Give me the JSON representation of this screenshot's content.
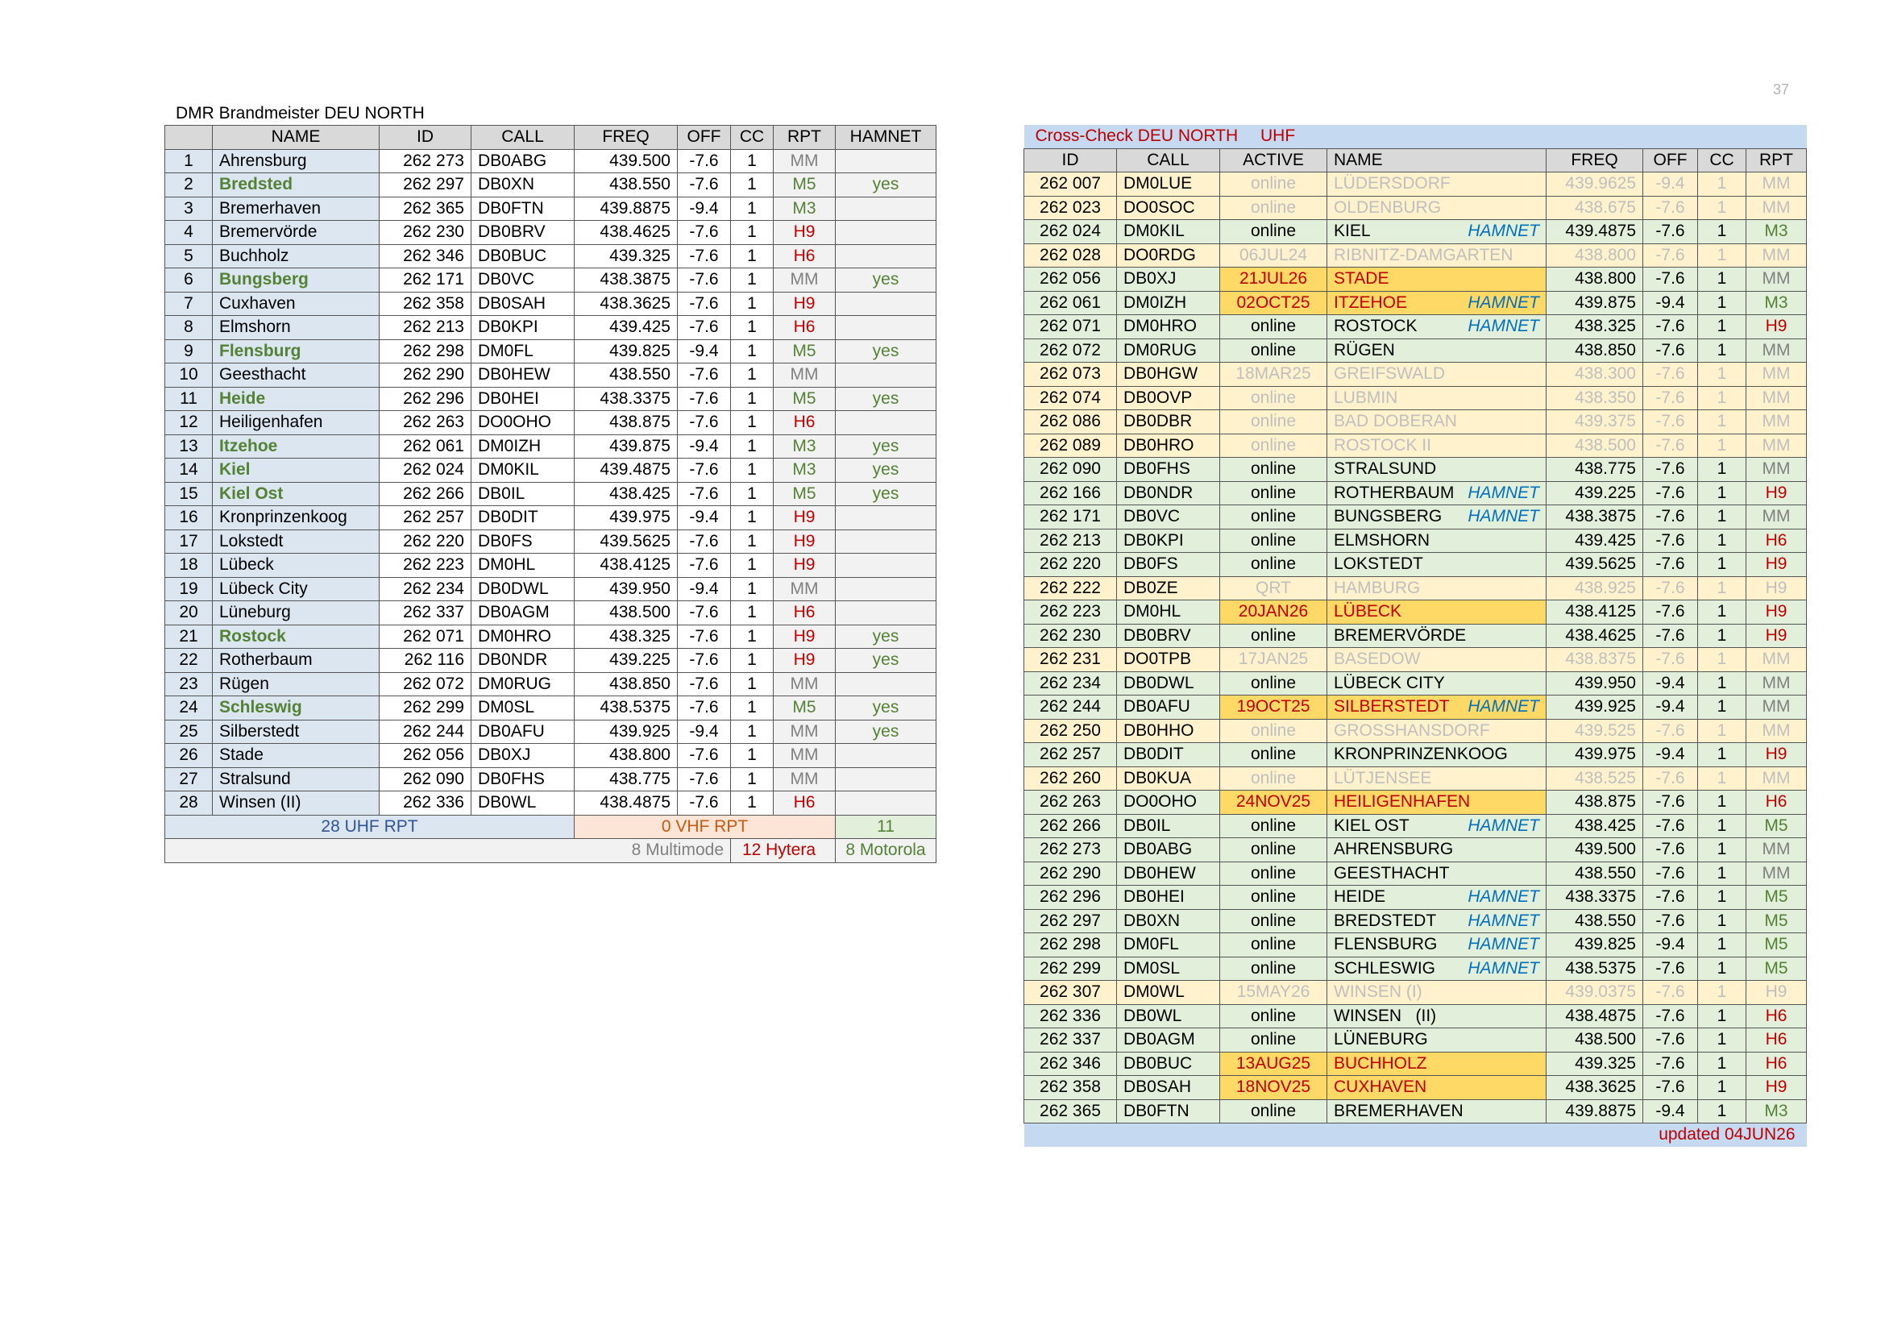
{
  "page_number": "37",
  "left": {
    "title": "DMR Brandmeister DEU NORTH",
    "headers": [
      "",
      "NAME",
      "ID",
      "CALL",
      "FREQ",
      "OFF",
      "CC",
      "RPT",
      "HAMNET"
    ],
    "rows": [
      {
        "n": "1",
        "name": "Ahrensburg",
        "id": "262 273",
        "call": "DB0ABG",
        "freq": "439.500",
        "off": "-7.6",
        "cc": "1",
        "rpt": "MM",
        "hamnet": "",
        "hl": false
      },
      {
        "n": "2",
        "name": "Bredsted",
        "id": "262 297",
        "call": "DB0XN",
        "freq": "438.550",
        "off": "-7.6",
        "cc": "1",
        "rpt": "M5",
        "hamnet": "yes",
        "hl": true
      },
      {
        "n": "3",
        "name": "Bremerhaven",
        "id": "262 365",
        "call": "DB0FTN",
        "freq": "439.8875",
        "off": "-9.4",
        "cc": "1",
        "rpt": "M3",
        "hamnet": "",
        "hl": false
      },
      {
        "n": "4",
        "name": "Bremervörde",
        "id": "262 230",
        "call": "DB0BRV",
        "freq": "438.4625",
        "off": "-7.6",
        "cc": "1",
        "rpt": "H9",
        "hamnet": "",
        "hl": false
      },
      {
        "n": "5",
        "name": "Buchholz",
        "id": "262 346",
        "call": "DB0BUC",
        "freq": "439.325",
        "off": "-7.6",
        "cc": "1",
        "rpt": "H6",
        "hamnet": "",
        "hl": false
      },
      {
        "n": "6",
        "name": "Bungsberg",
        "id": "262 171",
        "call": "DB0VC",
        "freq": "438.3875",
        "off": "-7.6",
        "cc": "1",
        "rpt": "MM",
        "hamnet": "yes",
        "hl": true
      },
      {
        "n": "7",
        "name": "Cuxhaven",
        "id": "262 358",
        "call": "DB0SAH",
        "freq": "438.3625",
        "off": "-7.6",
        "cc": "1",
        "rpt": "H9",
        "hamnet": "",
        "hl": false
      },
      {
        "n": "8",
        "name": "Elmshorn",
        "id": "262 213",
        "call": "DB0KPI",
        "freq": "439.425",
        "off": "-7.6",
        "cc": "1",
        "rpt": "H6",
        "hamnet": "",
        "hl": false
      },
      {
        "n": "9",
        "name": "Flensburg",
        "id": "262 298",
        "call": "DM0FL",
        "freq": "439.825",
        "off": "-9.4",
        "cc": "1",
        "rpt": "M5",
        "hamnet": "yes",
        "hl": true
      },
      {
        "n": "10",
        "name": "Geesthacht",
        "id": "262 290",
        "call": "DB0HEW",
        "freq": "438.550",
        "off": "-7.6",
        "cc": "1",
        "rpt": "MM",
        "hamnet": "",
        "hl": false
      },
      {
        "n": "11",
        "name": "Heide",
        "id": "262 296",
        "call": "DB0HEI",
        "freq": "438.3375",
        "off": "-7.6",
        "cc": "1",
        "rpt": "M5",
        "hamnet": "yes",
        "hl": true
      },
      {
        "n": "12",
        "name": "Heiligenhafen",
        "id": "262 263",
        "call": "DO0OHO",
        "freq": "438.875",
        "off": "-7.6",
        "cc": "1",
        "rpt": "H6",
        "hamnet": "",
        "hl": false
      },
      {
        "n": "13",
        "name": "Itzehoe",
        "id": "262 061",
        "call": "DM0IZH",
        "freq": "439.875",
        "off": "-9.4",
        "cc": "1",
        "rpt": "M3",
        "hamnet": "yes",
        "hl": true
      },
      {
        "n": "14",
        "name": "Kiel",
        "id": "262 024",
        "call": "DM0KIL",
        "freq": "439.4875",
        "off": "-7.6",
        "cc": "1",
        "rpt": "M3",
        "hamnet": "yes",
        "hl": true
      },
      {
        "n": "15",
        "name": "Kiel Ost",
        "id": "262 266",
        "call": "DB0IL",
        "freq": "438.425",
        "off": "-7.6",
        "cc": "1",
        "rpt": "M5",
        "hamnet": "yes",
        "hl": true
      },
      {
        "n": "16",
        "name": "Kronprinzenkoog",
        "id": "262 257",
        "call": "DB0DIT",
        "freq": "439.975",
        "off": "-9.4",
        "cc": "1",
        "rpt": "H9",
        "hamnet": "",
        "hl": false
      },
      {
        "n": "17",
        "name": "Lokstedt",
        "id": "262 220",
        "call": "DB0FS",
        "freq": "439.5625",
        "off": "-7.6",
        "cc": "1",
        "rpt": "H9",
        "hamnet": "",
        "hl": false
      },
      {
        "n": "18",
        "name": "Lübeck",
        "id": "262 223",
        "call": "DM0HL",
        "freq": "438.4125",
        "off": "-7.6",
        "cc": "1",
        "rpt": "H9",
        "hamnet": "",
        "hl": false
      },
      {
        "n": "19",
        "name": "Lübeck City",
        "id": "262 234",
        "call": "DB0DWL",
        "freq": "439.950",
        "off": "-9.4",
        "cc": "1",
        "rpt": "MM",
        "hamnet": "",
        "hl": false
      },
      {
        "n": "20",
        "name": "Lüneburg",
        "id": "262 337",
        "call": "DB0AGM",
        "freq": "438.500",
        "off": "-7.6",
        "cc": "1",
        "rpt": "H6",
        "hamnet": "",
        "hl": false
      },
      {
        "n": "21",
        "name": "Rostock",
        "id": "262 071",
        "call": "DM0HRO",
        "freq": "438.325",
        "off": "-7.6",
        "cc": "1",
        "rpt": "H9",
        "hamnet": "yes",
        "hl": true
      },
      {
        "n": "22",
        "name": "Rotherbaum",
        "id": "262 116",
        "call": "DB0NDR",
        "freq": "439.225",
        "off": "-7.6",
        "cc": "1",
        "rpt": "H9",
        "hamnet": "yes",
        "hl": false
      },
      {
        "n": "23",
        "name": "Rügen",
        "id": "262 072",
        "call": "DM0RUG",
        "freq": "438.850",
        "off": "-7.6",
        "cc": "1",
        "rpt": "MM",
        "hamnet": "",
        "hl": false
      },
      {
        "n": "24",
        "name": "Schleswig",
        "id": "262 299",
        "call": "DM0SL",
        "freq": "438.5375",
        "off": "-7.6",
        "cc": "1",
        "rpt": "M5",
        "hamnet": "yes",
        "hl": true
      },
      {
        "n": "25",
        "name": "Silberstedt",
        "id": "262 244",
        "call": "DB0AFU",
        "freq": "439.925",
        "off": "-9.4",
        "cc": "1",
        "rpt": "MM",
        "hamnet": "yes",
        "hl": false
      },
      {
        "n": "26",
        "name": "Stade",
        "id": "262 056",
        "call": "DB0XJ",
        "freq": "438.800",
        "off": "-7.6",
        "cc": "1",
        "rpt": "MM",
        "hamnet": "",
        "hl": false
      },
      {
        "n": "27",
        "name": "Stralsund",
        "id": "262 090",
        "call": "DB0FHS",
        "freq": "438.775",
        "off": "-7.6",
        "cc": "1",
        "rpt": "MM",
        "hamnet": "",
        "hl": false
      },
      {
        "n": "28",
        "name": "Winsen (II)",
        "id": "262 336",
        "call": "DB0WL",
        "freq": "438.4875",
        "off": "-7.6",
        "cc": "1",
        "rpt": "H6",
        "hamnet": "",
        "hl": false
      }
    ],
    "summary": {
      "uhf": "28  UHF RPT",
      "vhf": "0 VHF RPT",
      "hamnet_count": "11"
    },
    "vendors": {
      "multimode": "8 Multimode",
      "hytera": "12 Hytera",
      "motorola": "8 Motorola"
    }
  },
  "right": {
    "title": "Cross-Check DEU NORTH",
    "band": "UHF",
    "headers": [
      "ID",
      "CALL",
      "ACTIVE",
      "NAME",
      "FREQ",
      "OFF",
      "CC",
      "RPT"
    ],
    "rows": [
      {
        "id": "262 007",
        "call": "DM0LUE",
        "active": "online",
        "name": "LÜDERSDORF",
        "hamnet": "",
        "freq": "439.9625",
        "off": "-9.4",
        "cc": "1",
        "rpt": "MM",
        "st": "dim"
      },
      {
        "id": "262 023",
        "call": "DO0SOC",
        "active": "online",
        "name": "OLDENBURG",
        "hamnet": "",
        "freq": "438.675",
        "off": "-7.6",
        "cc": "1",
        "rpt": "MM",
        "st": "dim"
      },
      {
        "id": "262 024",
        "call": "DM0KIL",
        "active": "online",
        "name": "KIEL",
        "hamnet": "HAMNET",
        "freq": "439.4875",
        "off": "-7.6",
        "cc": "1",
        "rpt": "M3",
        "st": "ok"
      },
      {
        "id": "262 028",
        "call": "DO0RDG",
        "active": "06JUL24",
        "name": "RIBNITZ-DAMGARTEN",
        "hamnet": "",
        "freq": "438.800",
        "off": "-7.6",
        "cc": "1",
        "rpt": "MM",
        "st": "dim"
      },
      {
        "id": "262 056",
        "call": "DB0XJ",
        "active": "21JUL26",
        "name": "STADE",
        "hamnet": "",
        "freq": "438.800",
        "off": "-7.6",
        "cc": "1",
        "rpt": "MM",
        "st": "warn"
      },
      {
        "id": "262 061",
        "call": "DM0IZH",
        "active": "02OCT25",
        "name": "ITZEHOE",
        "hamnet": "HAMNET",
        "freq": "439.875",
        "off": "-9.4",
        "cc": "1",
        "rpt": "M3",
        "st": "warn"
      },
      {
        "id": "262 071",
        "call": "DM0HRO",
        "active": "online",
        "name": "ROSTOCK",
        "hamnet": "HAMNET",
        "freq": "438.325",
        "off": "-7.6",
        "cc": "1",
        "rpt": "H9",
        "st": "ok"
      },
      {
        "id": "262 072",
        "call": "DM0RUG",
        "active": "online",
        "name": "RÜGEN",
        "hamnet": "",
        "freq": "438.850",
        "off": "-7.6",
        "cc": "1",
        "rpt": "MM",
        "st": "ok"
      },
      {
        "id": "262 073",
        "call": "DB0HGW",
        "active": "18MAR25",
        "name": "GREIFSWALD",
        "hamnet": "",
        "freq": "438.300",
        "off": "-7.6",
        "cc": "1",
        "rpt": "MM",
        "st": "dim"
      },
      {
        "id": "262 074",
        "call": "DB0OVP",
        "active": "online",
        "name": "LUBMIN",
        "hamnet": "",
        "freq": "438.350",
        "off": "-7.6",
        "cc": "1",
        "rpt": "MM",
        "st": "dim"
      },
      {
        "id": "262 086",
        "call": "DB0DBR",
        "active": "online",
        "name": "BAD DOBERAN",
        "hamnet": "",
        "freq": "439.375",
        "off": "-7.6",
        "cc": "1",
        "rpt": "MM",
        "st": "dim"
      },
      {
        "id": "262 089",
        "call": "DB0HRO",
        "active": "online",
        "name": "ROSTOCK II",
        "hamnet": "",
        "freq": "438.500",
        "off": "-7.6",
        "cc": "1",
        "rpt": "MM",
        "st": "dim"
      },
      {
        "id": "262 090",
        "call": "DB0FHS",
        "active": "online",
        "name": "STRALSUND",
        "hamnet": "",
        "freq": "438.775",
        "off": "-7.6",
        "cc": "1",
        "rpt": "MM",
        "st": "ok"
      },
      {
        "id": "262 166",
        "call": "DB0NDR",
        "active": "online",
        "name": "ROTHERBAUM",
        "hamnet": "HAMNET",
        "freq": "439.225",
        "off": "-7.6",
        "cc": "1",
        "rpt": "H9",
        "st": "ok"
      },
      {
        "id": "262 171",
        "call": "DB0VC",
        "active": "online",
        "name": "BUNGSBERG",
        "hamnet": "HAMNET",
        "freq": "438.3875",
        "off": "-7.6",
        "cc": "1",
        "rpt": "MM",
        "st": "ok"
      },
      {
        "id": "262 213",
        "call": "DB0KPI",
        "active": "online",
        "name": "ELMSHORN",
        "hamnet": "",
        "freq": "439.425",
        "off": "-7.6",
        "cc": "1",
        "rpt": "H6",
        "st": "ok"
      },
      {
        "id": "262 220",
        "call": "DB0FS",
        "active": "online",
        "name": "LOKSTEDT",
        "hamnet": "",
        "freq": "439.5625",
        "off": "-7.6",
        "cc": "1",
        "rpt": "H9",
        "st": "ok"
      },
      {
        "id": "262 222",
        "call": "DB0ZE",
        "active": "QRT",
        "name": "HAMBURG",
        "hamnet": "",
        "freq": "438.925",
        "off": "-7.6",
        "cc": "1",
        "rpt": "H9",
        "st": "dim"
      },
      {
        "id": "262 223",
        "call": "DM0HL",
        "active": "20JAN26",
        "name": "LÜBECK",
        "hamnet": "",
        "freq": "438.4125",
        "off": "-7.6",
        "cc": "1",
        "rpt": "H9",
        "st": "warn"
      },
      {
        "id": "262 230",
        "call": "DB0BRV",
        "active": "online",
        "name": "BREMERVÖRDE",
        "hamnet": "",
        "freq": "438.4625",
        "off": "-7.6",
        "cc": "1",
        "rpt": "H9",
        "st": "ok"
      },
      {
        "id": "262 231",
        "call": "DO0TPB",
        "active": "17JAN25",
        "name": "BASEDOW",
        "hamnet": "",
        "freq": "438.8375",
        "off": "-7.6",
        "cc": "1",
        "rpt": "MM",
        "st": "dim"
      },
      {
        "id": "262 234",
        "call": "DB0DWL",
        "active": "online",
        "name": "LÜBECK CITY",
        "hamnet": "",
        "freq": "439.950",
        "off": "-9.4",
        "cc": "1",
        "rpt": "MM",
        "st": "ok"
      },
      {
        "id": "262 244",
        "call": "DB0AFU",
        "active": "19OCT25",
        "name": "SILBERSTEDT",
        "hamnet": "HAMNET",
        "freq": "439.925",
        "off": "-9.4",
        "cc": "1",
        "rpt": "MM",
        "st": "warn"
      },
      {
        "id": "262 250",
        "call": "DB0HHO",
        "active": "online",
        "name": "GROSSHANSDORF",
        "hamnet": "",
        "freq": "439.525",
        "off": "-7.6",
        "cc": "1",
        "rpt": "MM",
        "st": "dim"
      },
      {
        "id": "262 257",
        "call": "DB0DIT",
        "active": "online",
        "name": "KRONPRINZENKOOG",
        "hamnet": "",
        "freq": "439.975",
        "off": "-9.4",
        "cc": "1",
        "rpt": "H9",
        "st": "ok"
      },
      {
        "id": "262 260",
        "call": "DB0KUA",
        "active": "online",
        "name": "LÜTJENSEE",
        "hamnet": "",
        "freq": "438.525",
        "off": "-7.6",
        "cc": "1",
        "rpt": "MM",
        "st": "dim"
      },
      {
        "id": "262 263",
        "call": "DO0OHO",
        "active": "24NOV25",
        "name": "HEILIGENHAFEN",
        "hamnet": "",
        "freq": "438.875",
        "off": "-7.6",
        "cc": "1",
        "rpt": "H6",
        "st": "warn"
      },
      {
        "id": "262 266",
        "call": "DB0IL",
        "active": "online",
        "name": "KIEL OST",
        "hamnet": "HAMNET",
        "freq": "438.425",
        "off": "-7.6",
        "cc": "1",
        "rpt": "M5",
        "st": "ok"
      },
      {
        "id": "262 273",
        "call": "DB0ABG",
        "active": "online",
        "name": "AHRENSBURG",
        "hamnet": "",
        "freq": "439.500",
        "off": "-7.6",
        "cc": "1",
        "rpt": "MM",
        "st": "ok"
      },
      {
        "id": "262 290",
        "call": "DB0HEW",
        "active": "online",
        "name": "GEESTHACHT",
        "hamnet": "",
        "freq": "438.550",
        "off": "-7.6",
        "cc": "1",
        "rpt": "MM",
        "st": "ok"
      },
      {
        "id": "262 296",
        "call": "DB0HEI",
        "active": "online",
        "name": "HEIDE",
        "hamnet": "HAMNET",
        "freq": "438.3375",
        "off": "-7.6",
        "cc": "1",
        "rpt": "M5",
        "st": "ok"
      },
      {
        "id": "262 297",
        "call": "DB0XN",
        "active": "online",
        "name": "BREDSTEDT",
        "hamnet": "HAMNET",
        "freq": "438.550",
        "off": "-7.6",
        "cc": "1",
        "rpt": "M5",
        "st": "ok"
      },
      {
        "id": "262 298",
        "call": "DM0FL",
        "active": "online",
        "name": "FLENSBURG",
        "hamnet": "HAMNET",
        "freq": "439.825",
        "off": "-9.4",
        "cc": "1",
        "rpt": "M5",
        "st": "ok"
      },
      {
        "id": "262 299",
        "call": "DM0SL",
        "active": "online",
        "name": "SCHLESWIG",
        "hamnet": "HAMNET",
        "freq": "438.5375",
        "off": "-7.6",
        "cc": "1",
        "rpt": "M5",
        "st": "ok"
      },
      {
        "id": "262 307",
        "call": "DM0WL",
        "active": "15MAY26",
        "name": "WINSEN (I)",
        "hamnet": "",
        "freq": "439.0375",
        "off": "-7.6",
        "cc": "1",
        "rpt": "H9",
        "st": "dim"
      },
      {
        "id": "262 336",
        "call": "DB0WL",
        "active": "online",
        "name": "WINSEN   (II)",
        "hamnet": "",
        "freq": "438.4875",
        "off": "-7.6",
        "cc": "1",
        "rpt": "H6",
        "st": "ok"
      },
      {
        "id": "262 337",
        "call": "DB0AGM",
        "active": "online",
        "name": "LÜNEBURG",
        "hamnet": "",
        "freq": "438.500",
        "off": "-7.6",
        "cc": "1",
        "rpt": "H6",
        "st": "ok"
      },
      {
        "id": "262 346",
        "call": "DB0BUC",
        "active": "13AUG25",
        "name": "BUCHHOLZ",
        "hamnet": "",
        "freq": "439.325",
        "off": "-7.6",
        "cc": "1",
        "rpt": "H6",
        "st": "warn"
      },
      {
        "id": "262 358",
        "call": "DB0SAH",
        "active": "18NOV25",
        "name": "CUXHAVEN",
        "hamnet": "",
        "freq": "438.3625",
        "off": "-7.6",
        "cc": "1",
        "rpt": "H9",
        "st": "warn"
      },
      {
        "id": "262 365",
        "call": "DB0FTN",
        "active": "online",
        "name": "BREMERHAVEN",
        "hamnet": "",
        "freq": "439.8875",
        "off": "-9.4",
        "cc": "1",
        "rpt": "M3",
        "st": "ok"
      }
    ],
    "updated": "updated 04JUN26"
  },
  "colors": {
    "title_red": "#c00000",
    "hamnet_blue": "#0070c0",
    "green_text": "#548235",
    "header_blue": "#c5d9f1",
    "online_green": "#e2efda",
    "stale_cream": "#fff2cc",
    "warn_orange": "#ffd966"
  }
}
